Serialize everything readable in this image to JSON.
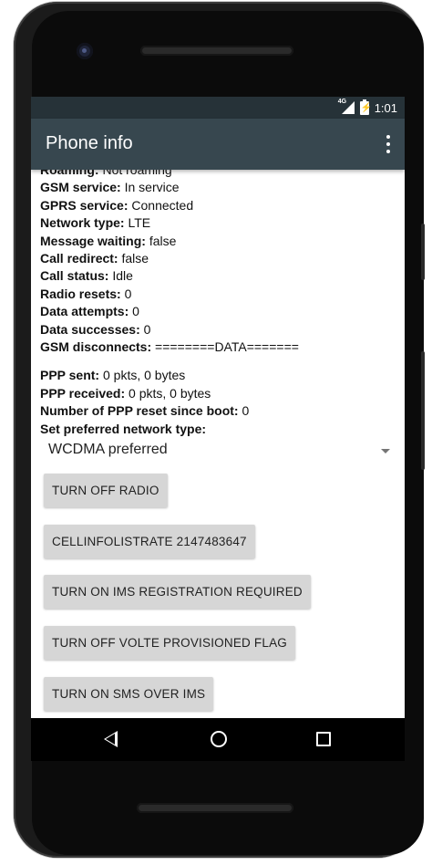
{
  "status_bar": {
    "network_label": "4G",
    "time": "1:01",
    "icons": [
      "signal-4g-icon",
      "battery-charging-icon"
    ]
  },
  "app_bar": {
    "title": "Phone info",
    "menu_icon": "overflow-menu-icon"
  },
  "info_rows": [
    {
      "label": "Roaming:",
      "value": "Not roaming"
    },
    {
      "label": "GSM service:",
      "value": "In service"
    },
    {
      "label": "GPRS service:",
      "value": "Connected"
    },
    {
      "label": "Network type:",
      "value": "LTE"
    },
    {
      "label": "Message waiting:",
      "value": "false"
    },
    {
      "label": "Call redirect:",
      "value": "false"
    },
    {
      "label": "Call status:",
      "value": "Idle"
    },
    {
      "label": "Radio resets:",
      "value": "0"
    },
    {
      "label": "Data attempts:",
      "value": "0"
    },
    {
      "label": "Data successes:",
      "value": "0"
    },
    {
      "label": "GSM disconnects:",
      "value": "========DATA======="
    }
  ],
  "ppp_rows": [
    {
      "label": "PPP sent:",
      "value": "0 pkts, 0 bytes"
    },
    {
      "label": "PPP received:",
      "value": "0 pkts, 0 bytes"
    },
    {
      "label": "Number of PPP reset since boot:",
      "value": "0"
    },
    {
      "label": "Set preferred network type:",
      "value": ""
    }
  ],
  "network_type_spinner": {
    "selected": "WCDMA preferred"
  },
  "buttons": {
    "radio": "TURN OFF RADIO",
    "cellinfo": "CELLINFOLISTRATE 2147483647",
    "ims_registration": "TURN ON IMS REGISTRATION REQUIRED",
    "volte_flag": "TURN OFF VOLTE PROVISIONED FLAG",
    "sms_over_ims": "TURN ON SMS OVER IMS"
  },
  "nav_bar": {
    "icons": [
      "back-icon",
      "home-icon",
      "recents-icon"
    ]
  }
}
